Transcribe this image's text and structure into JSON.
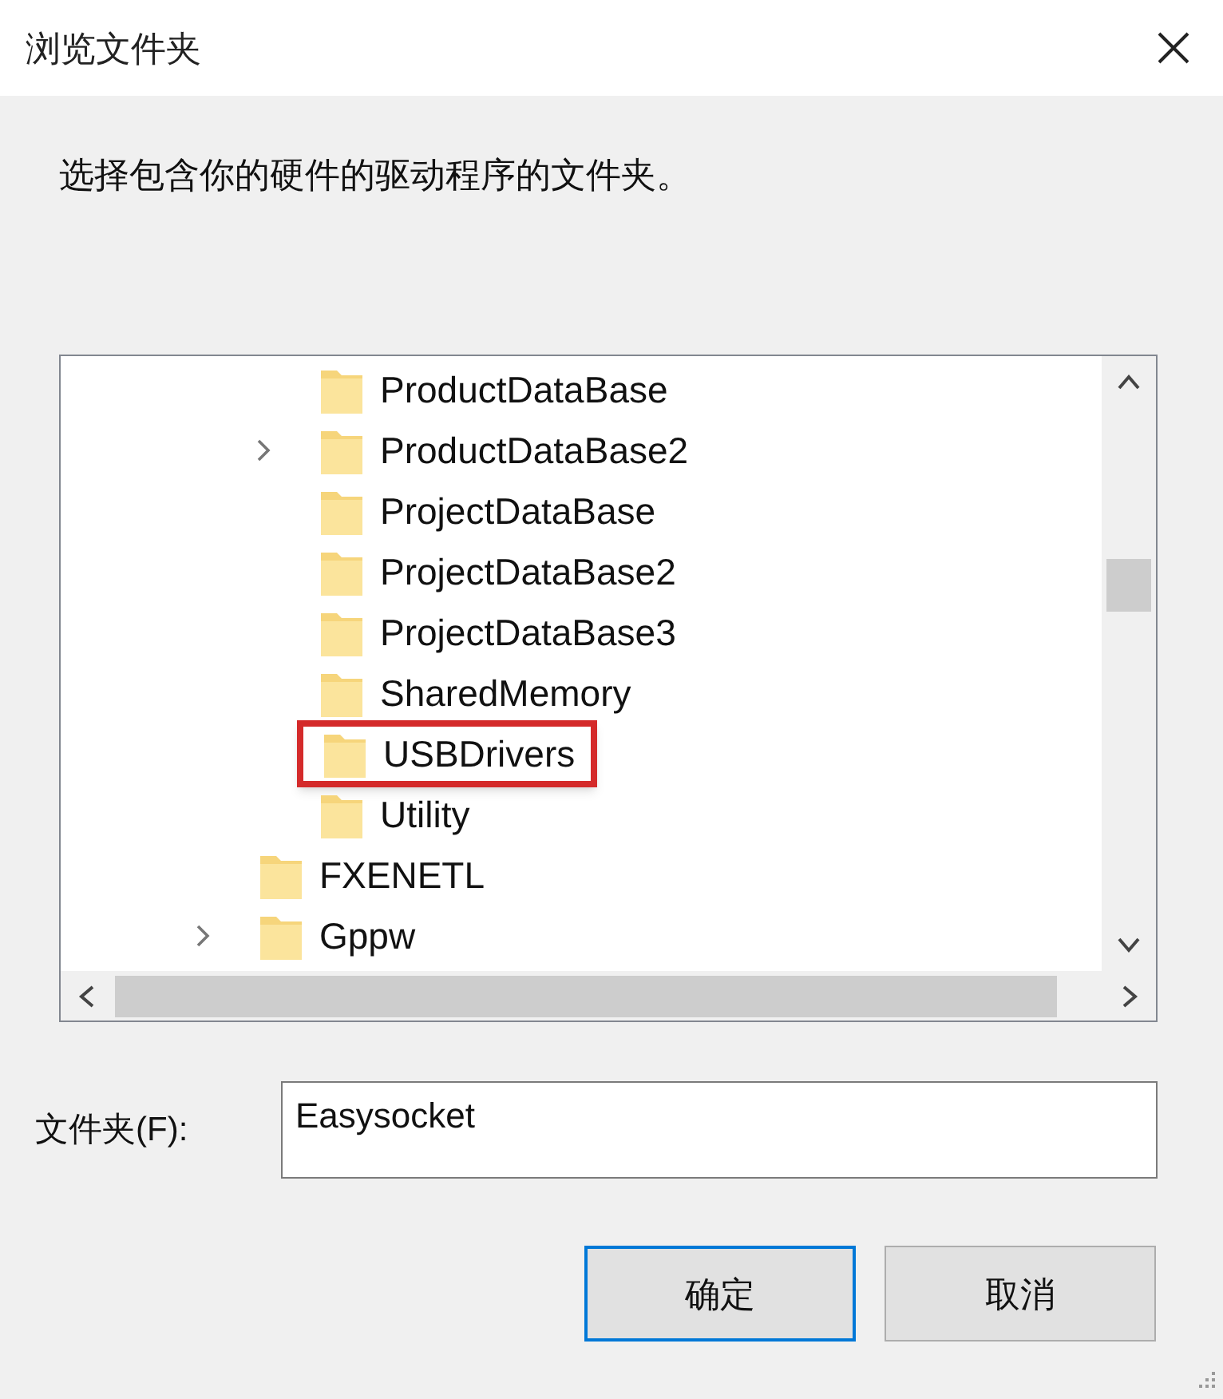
{
  "window": {
    "title": "浏览文件夹"
  },
  "prompt": "选择包含你的硬件的驱动程序的文件夹。",
  "tree": {
    "items": [
      {
        "children": [
          {
            "label": "ProductDataBase",
            "expandable": false,
            "highlighted": false
          },
          {
            "label": "ProductDataBase2",
            "expandable": true,
            "highlighted": false
          },
          {
            "label": "ProjectDataBase",
            "expandable": false,
            "highlighted": false
          },
          {
            "label": "ProjectDataBase2",
            "expandable": false,
            "highlighted": false
          },
          {
            "label": "ProjectDataBase3",
            "expandable": false,
            "highlighted": false
          },
          {
            "label": "SharedMemory",
            "expandable": false,
            "highlighted": false
          },
          {
            "label": "USBDrivers",
            "expandable": false,
            "highlighted": true
          },
          {
            "label": "Utility",
            "expandable": false,
            "highlighted": false
          }
        ]
      },
      {
        "label": "FXENETL",
        "expandable": false,
        "highlighted": false
      },
      {
        "label": "Gppw",
        "expandable": true,
        "highlighted": false
      }
    ]
  },
  "folder_field": {
    "label": "文件夹(F):",
    "value": "Easysocket"
  },
  "buttons": [
    {
      "label": "确定",
      "default": true
    },
    {
      "label": "取消",
      "default": false
    }
  ]
}
